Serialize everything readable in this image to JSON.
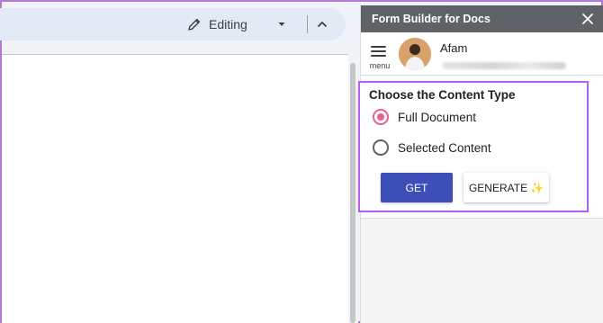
{
  "toolbar": {
    "mode_label": "Editing",
    "mode_icon": "pencil-icon",
    "collapse_icon": "chevron-up-icon"
  },
  "sidebar": {
    "title": "Form Builder for Docs",
    "close_icon": "close-icon",
    "menu_label": "menu",
    "user": {
      "name": "Afam"
    },
    "content_type": {
      "heading": "Choose the Content Type",
      "options": [
        {
          "label": "Full Document",
          "selected": true
        },
        {
          "label": "Selected Content",
          "selected": false
        }
      ]
    },
    "buttons": {
      "get_label": "GET",
      "generate_label": "GENERATE",
      "generate_icon": "sparkle-icon"
    }
  },
  "colors": {
    "header_bg": "#5f6368",
    "get_button_bg": "#3e4eb8",
    "radio_selected": "#e8618c",
    "highlight_border": "#b55ef0"
  }
}
